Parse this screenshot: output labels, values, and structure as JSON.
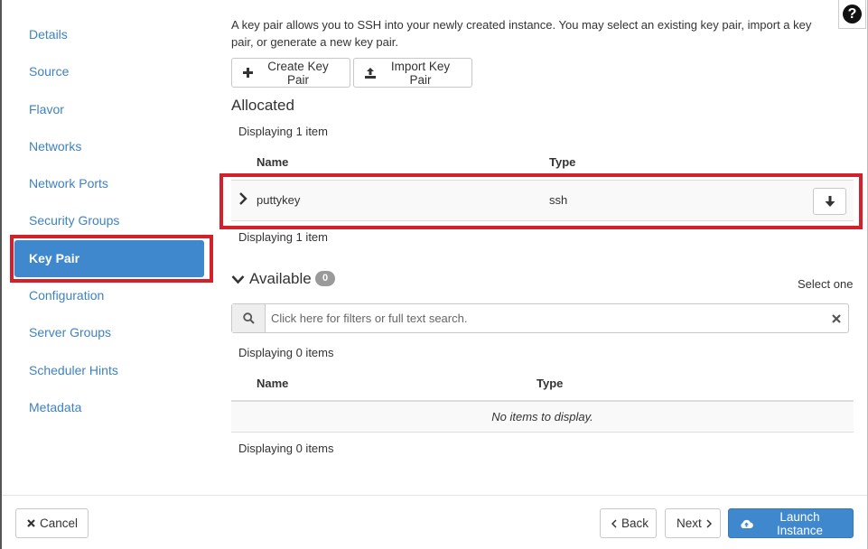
{
  "sidebar": {
    "items": [
      {
        "label": "Details"
      },
      {
        "label": "Source"
      },
      {
        "label": "Flavor"
      },
      {
        "label": "Networks"
      },
      {
        "label": "Network Ports"
      },
      {
        "label": "Security Groups"
      },
      {
        "label": "Key Pair",
        "active": true
      },
      {
        "label": "Configuration"
      },
      {
        "label": "Server Groups"
      },
      {
        "label": "Scheduler Hints"
      },
      {
        "label": "Metadata"
      }
    ]
  },
  "help": {
    "label": "?"
  },
  "description": "A key pair allows you to SSH into your newly created instance. You may select an existing key pair, import a key pair, or generate a new key pair.",
  "toolbar": {
    "create_label": "Create Key Pair",
    "import_label": "Import Key Pair"
  },
  "allocated": {
    "title": "Allocated",
    "count_text_top": "Displaying 1 item",
    "count_text_bottom": "Displaying 1 item",
    "columns": {
      "name": "Name",
      "type": "Type"
    },
    "rows": [
      {
        "name": "puttykey",
        "type": "ssh"
      }
    ]
  },
  "available": {
    "title": "Available",
    "badge": "0",
    "select_hint": "Select one",
    "search_placeholder": "Click here for filters or full text search.",
    "count_text_top": "Displaying 0 items",
    "count_text_bottom": "Displaying 0 items",
    "columns": {
      "name": "Name",
      "type": "Type"
    },
    "empty_text": "No items to display."
  },
  "footer": {
    "cancel_label": "Cancel",
    "back_label": "Back",
    "next_label": "Next",
    "launch_label": "Launch Instance"
  },
  "colors": {
    "primary": "#3f88cd",
    "link": "#3e82c2",
    "highlight": "#d3202a"
  }
}
